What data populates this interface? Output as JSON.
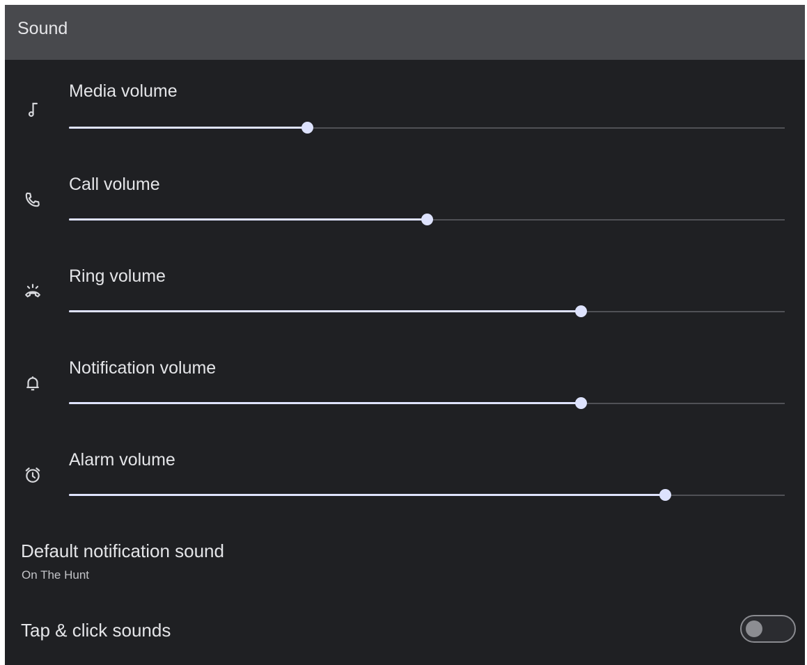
{
  "appbar": {
    "title": "Sound"
  },
  "volumes": [
    {
      "label": "Media volume",
      "icon": "music-note-icon",
      "level": 0.333
    },
    {
      "label": "Call volume",
      "icon": "phone-icon",
      "level": 0.5
    },
    {
      "label": "Ring volume",
      "icon": "ringer-icon",
      "level": 0.715
    },
    {
      "label": "Notification volume",
      "icon": "bell-icon",
      "level": 0.715
    },
    {
      "label": "Alarm volume",
      "icon": "alarm-clock-icon",
      "level": 0.833
    }
  ],
  "default_notification": {
    "title": "Default notification sound",
    "summary": "On The Hunt"
  },
  "tap_click": {
    "title": "Tap & click sounds",
    "enabled": false
  },
  "colors": {
    "background": "#1f2023",
    "appbar": "#48494d",
    "slider_active": "#dfe3ff",
    "slider_track": "#505156",
    "toggle_off": "#8c8d92"
  }
}
